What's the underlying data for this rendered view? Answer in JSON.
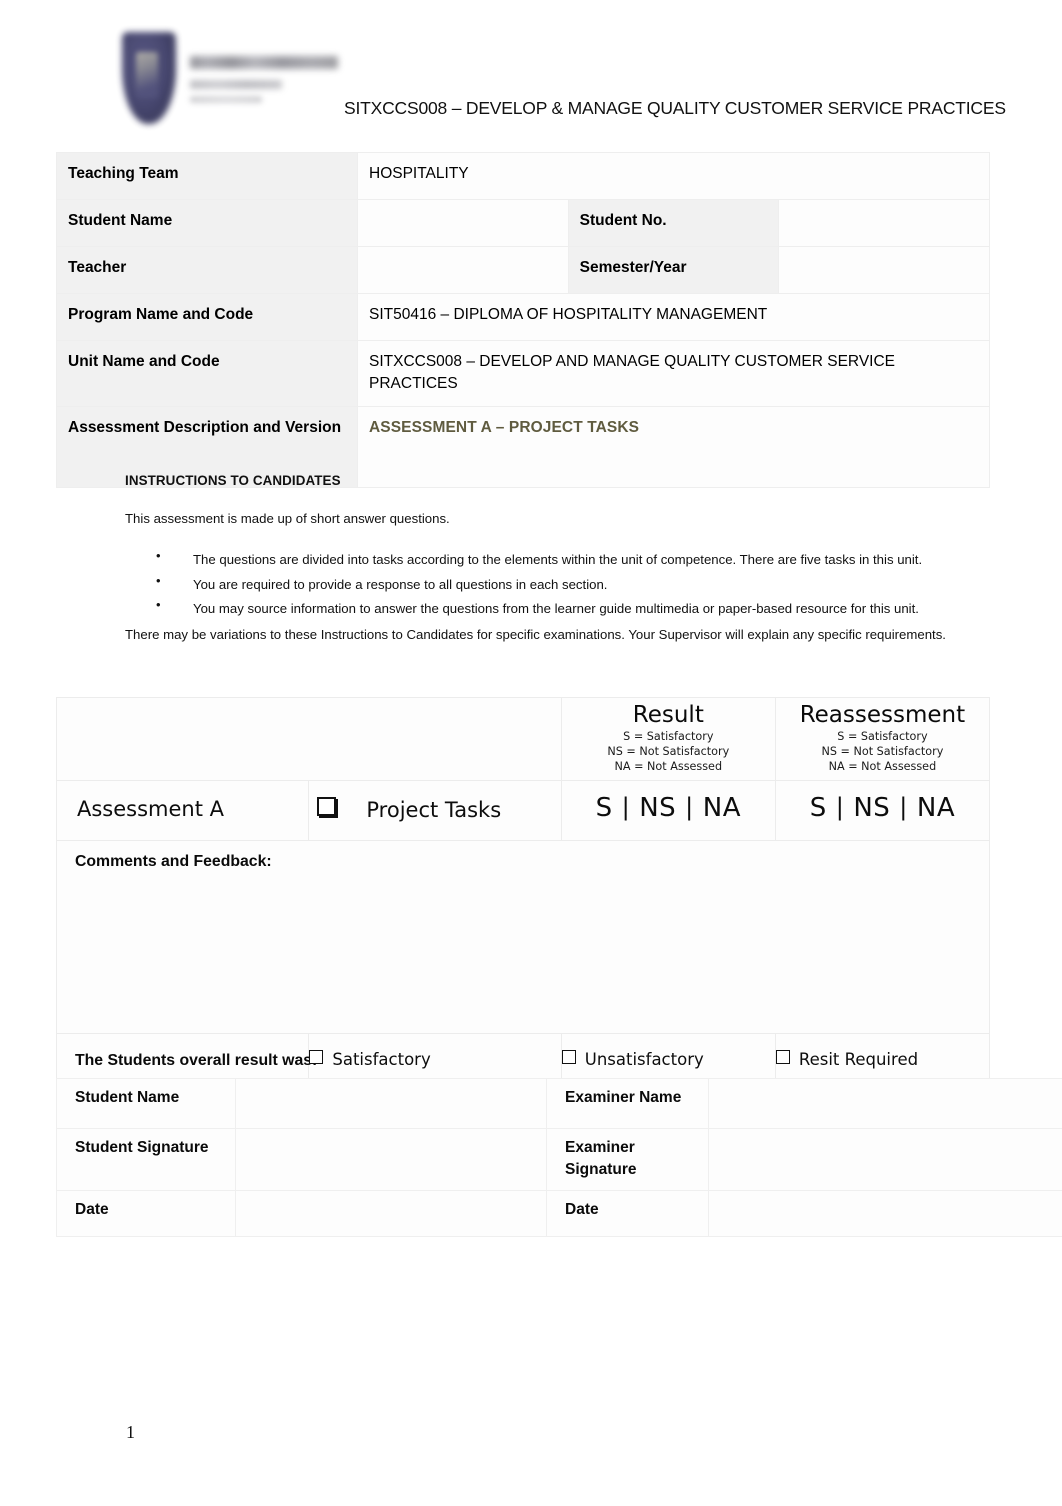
{
  "header": {
    "title": "SITXCCS008 – DEVELOP & MANAGE QUALITY CUSTOMER SERVICE PRACTICES",
    "logo_alt": "institution-crest-logo"
  },
  "info_table": {
    "rows": [
      {
        "label": "Teaching Team",
        "value": "HOSPITALITY",
        "sublabel": "",
        "subvalue": ""
      },
      {
        "label": "Student Name",
        "value": "",
        "sublabel": "Student No.",
        "subvalue": ""
      },
      {
        "label": "Teacher",
        "value": "",
        "sublabel": "Semester/Year",
        "subvalue": ""
      },
      {
        "label": "Program Name and Code",
        "value": "SIT50416 – DIPLOMA OF HOSPITALITY MANAGEMENT",
        "sublabel": "",
        "subvalue": ""
      },
      {
        "label": "Unit Name and Code",
        "value": "SITXCCS008 – DEVELOP AND MANAGE QUALITY CUSTOMER SERVICE PRACTICES",
        "sublabel": "",
        "subvalue": ""
      },
      {
        "label": "Assessment Description and Version",
        "value": "ASSESSMENT A – PROJECT TASKS",
        "sublabel": "",
        "subvalue": ""
      }
    ]
  },
  "instructions": {
    "heading": "INSTRUCTIONS TO CANDIDATES",
    "intro": "This assessment is made up of short answer questions.",
    "bullets": [
      "The questions are divided into tasks according to the elements within the unit of competence. There are five tasks in this unit.",
      "You are required to provide a response to all questions in each section.",
      "You may source information to answer the questions from the learner guide multimedia or paper-based resource for this unit."
    ],
    "closing": "There may be variations to these Instructions to Candidates for specific examinations. Your Supervisor will explain any specific requirements."
  },
  "grading": {
    "result_header": "Result",
    "reassessment_header": "Reassessment",
    "legend": [
      "S = Satisfactory",
      "NS = Not Satisfactory",
      "NA = Not Assessed"
    ],
    "assessment_name": "Assessment A",
    "assessment_task": "Project Tasks",
    "options": {
      "s": "S",
      "ns": "NS",
      "na": "NA",
      "separator": "|"
    },
    "comments_label": "Comments and Feedback:",
    "overall_label": "The Students overall result was:",
    "overall_options": [
      "Satisfactory",
      "Unsatisfactory",
      "Resit Required"
    ]
  },
  "signature_table": {
    "rows": [
      {
        "left_label": "Student Name",
        "left_value": "",
        "right_label": "Examiner Name",
        "right_value": ""
      },
      {
        "left_label": "Student Signature",
        "left_value": "",
        "right_label": "Examiner Signature",
        "right_value": ""
      },
      {
        "left_label": "Date",
        "left_value": "",
        "right_label": "Date",
        "right_value": ""
      }
    ]
  },
  "footer": {
    "page_number": "1"
  },
  "colors": {
    "label_cell_background": "#f1f1f1",
    "assessment_version_text": "#5f5b3f",
    "border": "#ececec",
    "logo_navy": "#3a3a66"
  }
}
